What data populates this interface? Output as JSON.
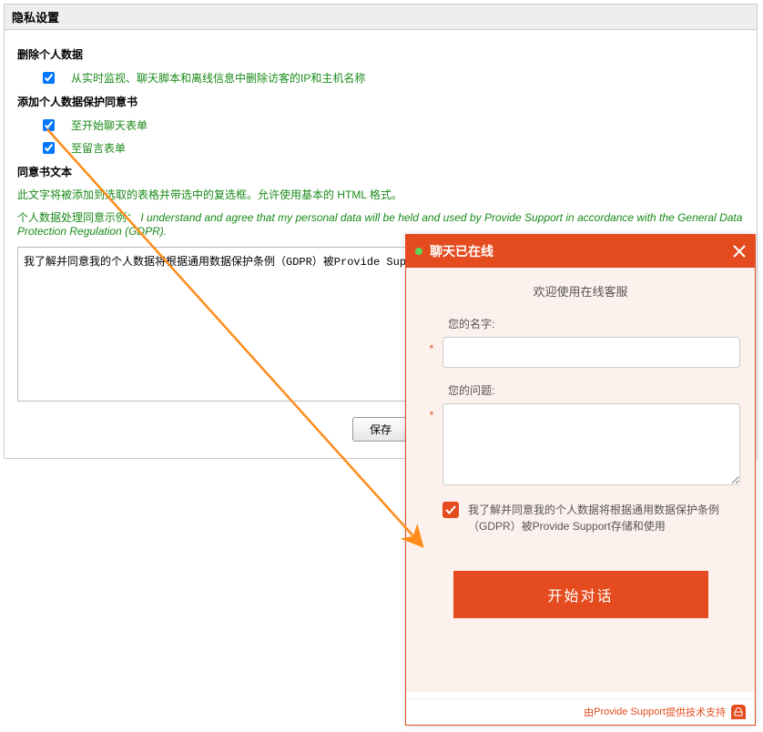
{
  "panel": {
    "title": "隐私设置",
    "delete_section": "删除个人数据",
    "delete_item": "从实时监视、聊天脚本和离线信息中删除访客的IP和主机名称",
    "add_section": "添加个人数据保护同意书",
    "add_item1": "至开始聊天表单",
    "add_item2": "至留言表单",
    "text_section": "同意书文本",
    "text_desc": "此文字将被添加到选取的表格并带选中的复选框。允许使用基本的 HTML 格式。",
    "example_prefix": "个人数据处理同意示例：",
    "example_italic": "I understand and agree that my personal data will be held and used by Provide Support in accordance with the General Data Protection Regulation (GDPR).",
    "textarea_value": "我了解并同意我的个人数据将根据通用数据保护条例（GDPR）被Provide Support存储和使用",
    "save_btn": "保存"
  },
  "chat": {
    "header_title": "聊天已在线",
    "welcome": "欢迎使用在线客服",
    "name_label": "您的名字:",
    "question_label": "您的问题:",
    "consent_text": "我了解并同意我的个人数据将根据通用数据保护条例（GDPR）被Provide Support存储和使用",
    "start_btn": "开始对话",
    "footer_prefix": "由 ",
    "footer_brand": "Provide Support",
    "footer_suffix": " 提供技术支持"
  }
}
